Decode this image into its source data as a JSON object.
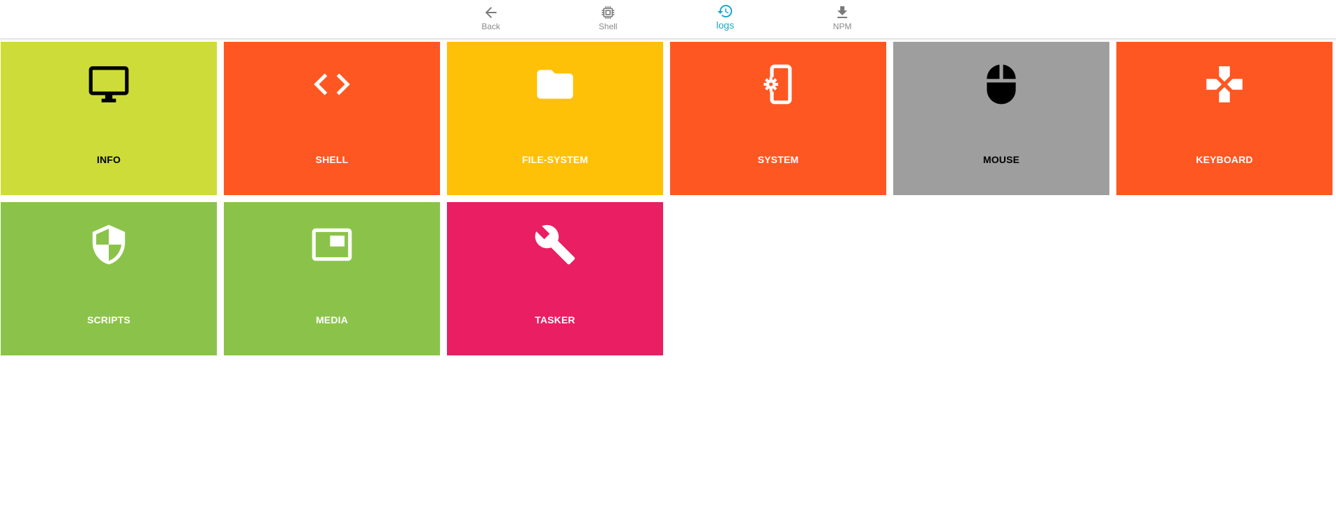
{
  "nav": {
    "items": [
      {
        "label": "Back",
        "icon": "arrow-left-icon",
        "active": false
      },
      {
        "label": "Shell",
        "icon": "chip-icon",
        "active": false
      },
      {
        "label": "logs",
        "icon": "history-icon",
        "active": true
      },
      {
        "label": "NPM",
        "icon": "download-icon",
        "active": false
      }
    ],
    "active_color": "#1aa8c9",
    "inactive_color": "#8a8a8a"
  },
  "tiles": [
    {
      "label": "INFO",
      "icon": "monitor-icon",
      "color": "#cddc39",
      "text_color": "#000000"
    },
    {
      "label": "SHELL",
      "icon": "code-icon",
      "color": "#ff5722",
      "text_color": "#ffffff"
    },
    {
      "label": "FILE-SYSTEM",
      "icon": "folder-icon",
      "color": "#ffc107",
      "text_color": "#ffffff"
    },
    {
      "label": "SYSTEM",
      "icon": "phone-settings-icon",
      "color": "#ff5722",
      "text_color": "#ffffff"
    },
    {
      "label": "MOUSE",
      "icon": "mouse-icon",
      "color": "#9e9e9e",
      "text_color": "#000000"
    },
    {
      "label": "KEYBOARD",
      "icon": "gamepad-icon",
      "color": "#ff5722",
      "text_color": "#ffffff"
    },
    {
      "label": "SCRIPTS",
      "icon": "shield-icon",
      "color": "#8bc34a",
      "text_color": "#ffffff"
    },
    {
      "label": "MEDIA",
      "icon": "picture-in-picture-icon",
      "color": "#8bc34a",
      "text_color": "#ffffff"
    },
    {
      "label": "TASKER",
      "icon": "wrench-icon",
      "color": "#e91e63",
      "text_color": "#ffffff"
    }
  ]
}
